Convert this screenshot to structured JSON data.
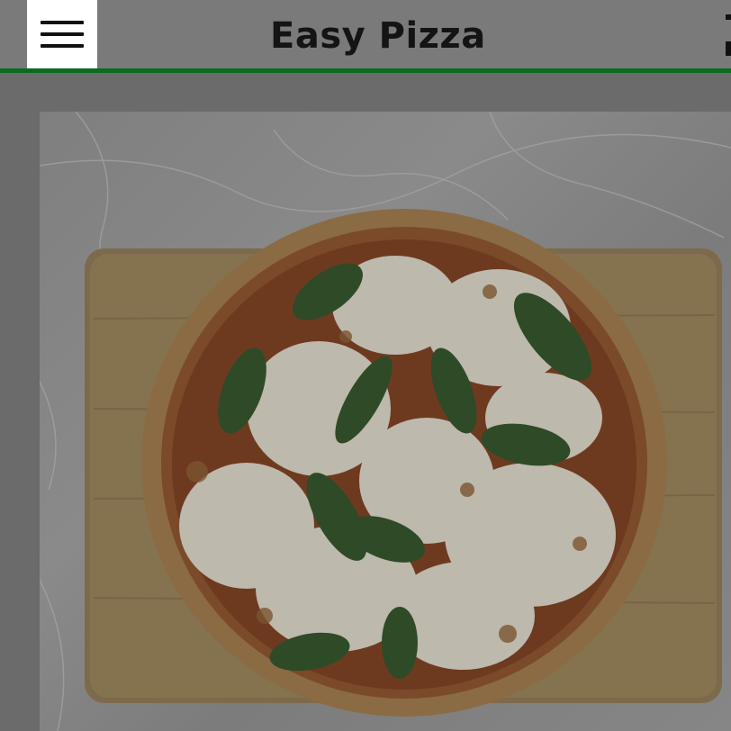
{
  "app": {
    "title": "Easy Pizza"
  },
  "header": {
    "menu_icon": "hamburger-menu-icon",
    "right_icon": "overflow-icon",
    "accent_color": "#0b6b1f"
  },
  "hero": {
    "image_subject": "margherita-pizza-on-cutting-board"
  }
}
